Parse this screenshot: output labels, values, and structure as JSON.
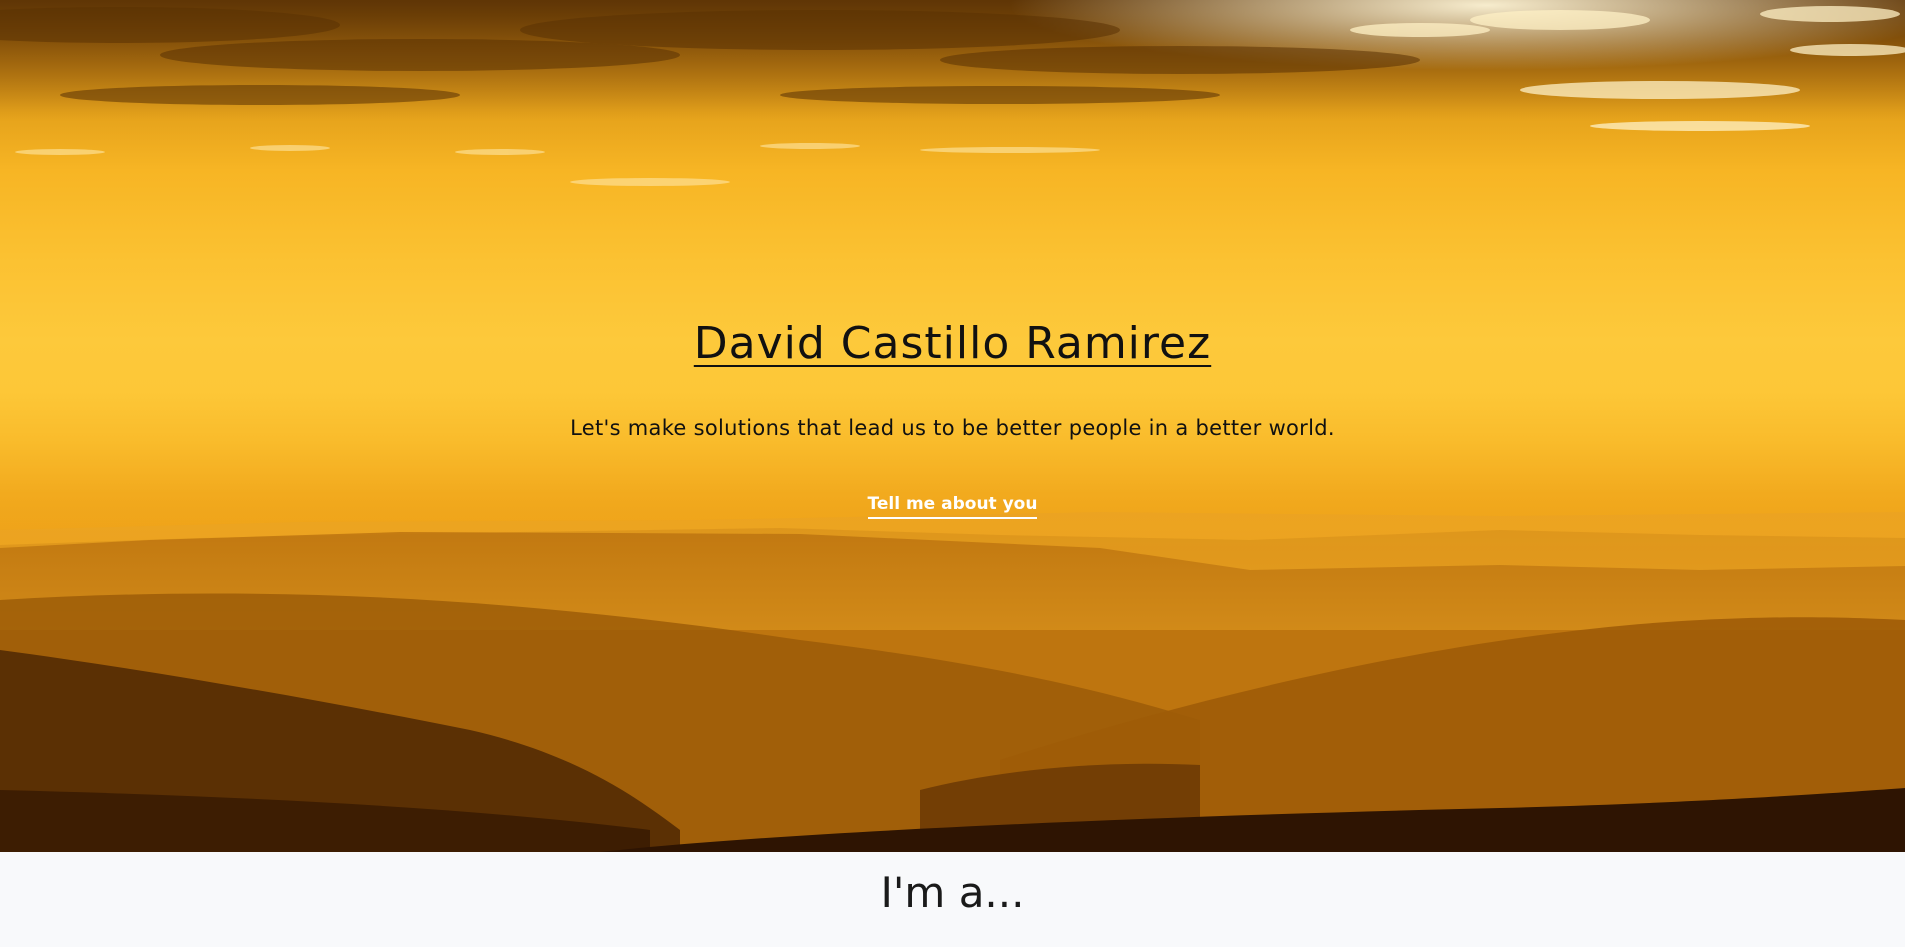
{
  "hero": {
    "title": "David Castillo Ramirez",
    "tagline": "Let's make solutions that lead us to be better people in a better world.",
    "cta_label": "Tell me about you"
  },
  "about": {
    "heading": "I'm a..."
  },
  "colors": {
    "sky_top": "#7a4a07",
    "sky_glow": "#fdc93b",
    "hills_dark": "#3a1c02",
    "section_background": "#f8f9fb",
    "title_text": "#111111",
    "cta_text": "#ffffff"
  }
}
